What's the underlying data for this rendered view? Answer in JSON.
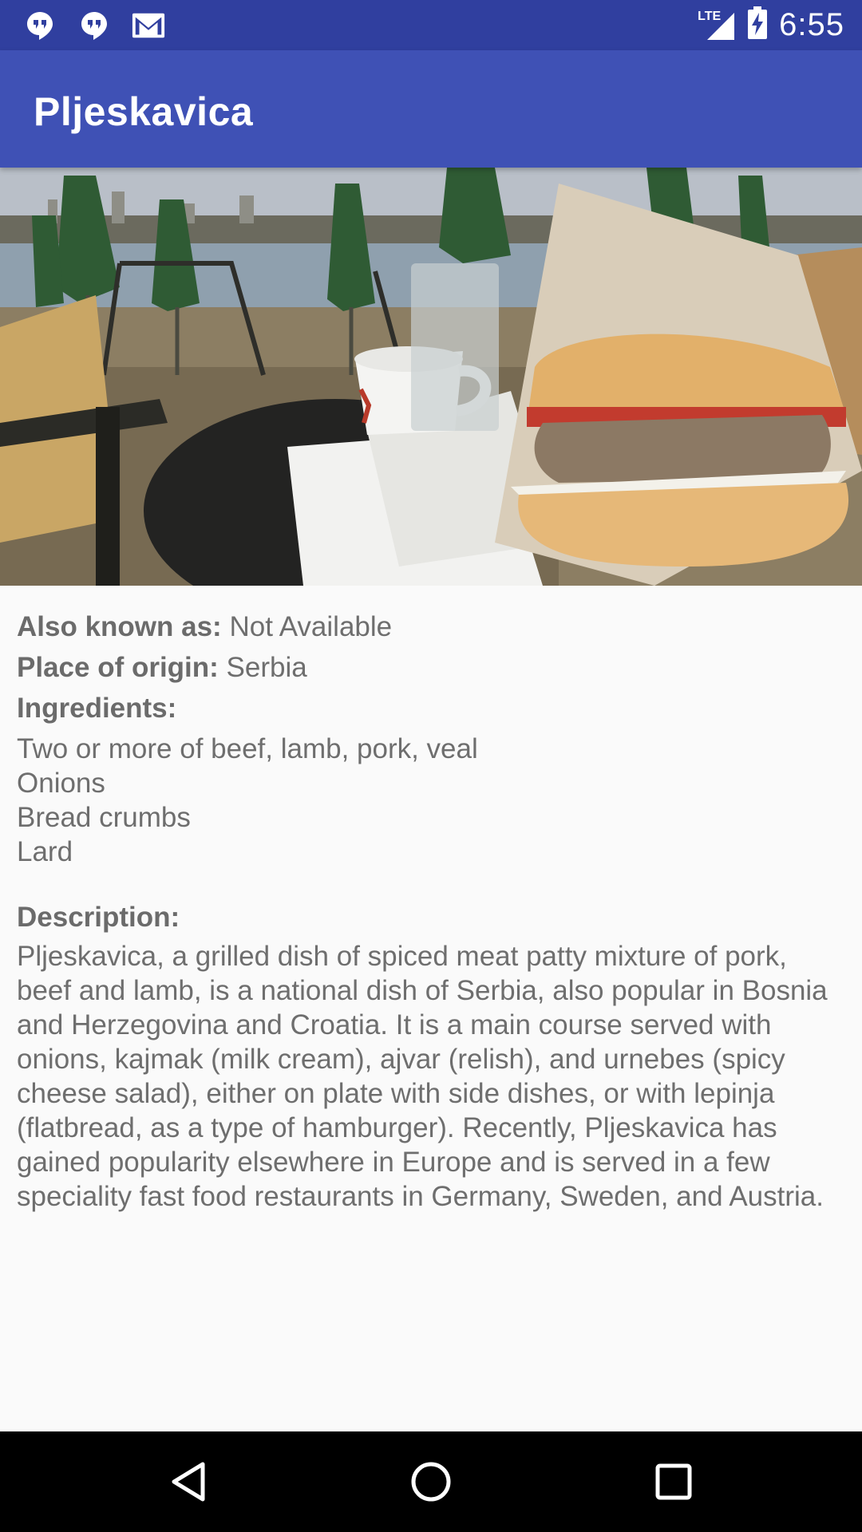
{
  "status_bar": {
    "time": "6:55",
    "network": "LTE",
    "notification_icons": [
      "hangouts-icon",
      "hangouts-icon",
      "gmail-icon"
    ]
  },
  "app_bar": {
    "title": "Pljeskavica"
  },
  "hero_image": {
    "subject": "pljeskavica-burger-photo"
  },
  "details": {
    "also_known_as_label": "Also known as:",
    "also_known_as_value": "Not Available",
    "place_of_origin_label": "Place of origin:",
    "place_of_origin_value": "Serbia",
    "ingredients_label": "Ingredients:",
    "ingredients": [
      "Two or more of beef, lamb, pork, veal",
      "Onions",
      "Bread crumbs",
      "Lard"
    ],
    "description_label": "Description:",
    "description": "Pljeskavica, a grilled dish of spiced meat patty mixture of pork, beef and lamb, is a national dish of Serbia, also popular in Bosnia and Herzegovina and Croatia. It is a main course served with onions, kajmak (milk cream), ajvar (relish), and urnebes (spicy cheese salad), either on plate with side dishes, or with lepinja (flatbread, as a type of hamburger). Recently, Pljeskavica has gained popularity elsewhere in Europe and is served in a few speciality fast food restaurants in Germany, Sweden, and Austria."
  },
  "nav_bar": {
    "buttons": [
      "back-icon",
      "home-icon",
      "recents-icon"
    ]
  },
  "colors": {
    "status_bar": "#303F9F",
    "app_bar": "#3F51B5",
    "background": "#FAFAFA",
    "text": "#6E6E6E"
  }
}
